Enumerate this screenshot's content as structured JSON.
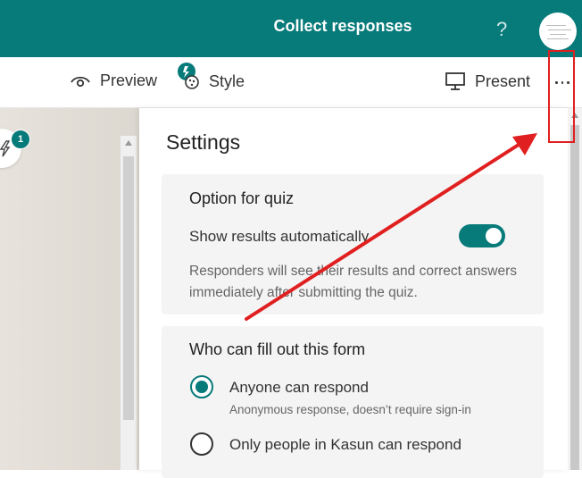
{
  "header": {
    "help_label": "?",
    "brand_color": "#077a7a"
  },
  "toolbar": {
    "preview_label": "Preview",
    "style_label": "Style",
    "collect_label": "Collect responses",
    "present_label": "Present"
  },
  "canvas": {
    "badge_count": "1"
  },
  "settings": {
    "title": "Settings",
    "quiz": {
      "title": "Option for quiz",
      "show_results_label": "Show results automatically",
      "show_results_on": true,
      "description": "Responders will see their results and correct answers immediately after submitting the quiz."
    },
    "who": {
      "title": "Who can fill out this form",
      "options": [
        {
          "label": "Anyone can respond",
          "sub": "Anonymous response, doesn’t require sign-in",
          "selected": true
        },
        {
          "label": "Only people in Kasun can respond",
          "sub": "",
          "selected": false
        }
      ]
    }
  },
  "annotation": {
    "arrow_color": "#e02020",
    "box_color": "#e02020"
  }
}
